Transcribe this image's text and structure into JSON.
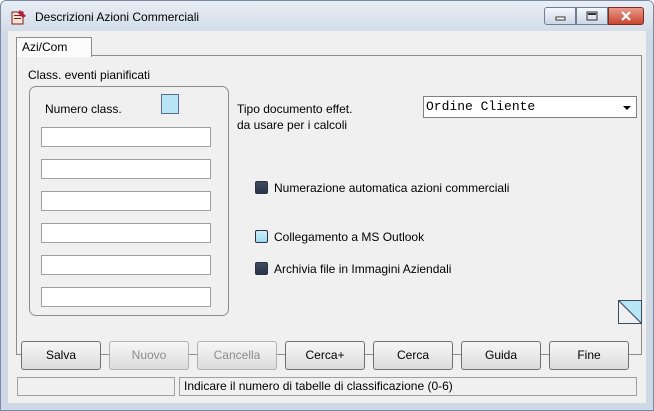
{
  "window": {
    "title": "Descrizioni Azioni Commerciali",
    "controls": [
      "minimize-icon",
      "maximize-icon",
      "close-icon"
    ]
  },
  "tab": {
    "label": "Azi/Com"
  },
  "group": {
    "label": "Class. eventi pianificati",
    "numero_label": "Numero class.",
    "numero_color": "#b9e6f7",
    "fields": [
      "",
      "",
      "",
      "",
      "",
      ""
    ]
  },
  "tipo": {
    "label_line1": "Tipo documento effet.",
    "label_line2": "da usare per i calcoli",
    "value": "Ordine Cliente"
  },
  "options": [
    {
      "label": "Numerazione automatica azioni commerciali",
      "state": "dark"
    },
    {
      "label": "Collegamento a MS Outlook",
      "state": "light"
    },
    {
      "label": "Archivia file in Immagini Aziendali",
      "state": "dark"
    }
  ],
  "buttons": {
    "salva": "Salva",
    "nuovo": "Nuovo",
    "cancella": "Cancella",
    "cerca_plus": "Cerca+",
    "cerca": "Cerca",
    "guida": "Guida",
    "fine": "Fine"
  },
  "status": {
    "left": "",
    "right": "Indicare il numero di tabelle di classificazione (0-6)"
  }
}
